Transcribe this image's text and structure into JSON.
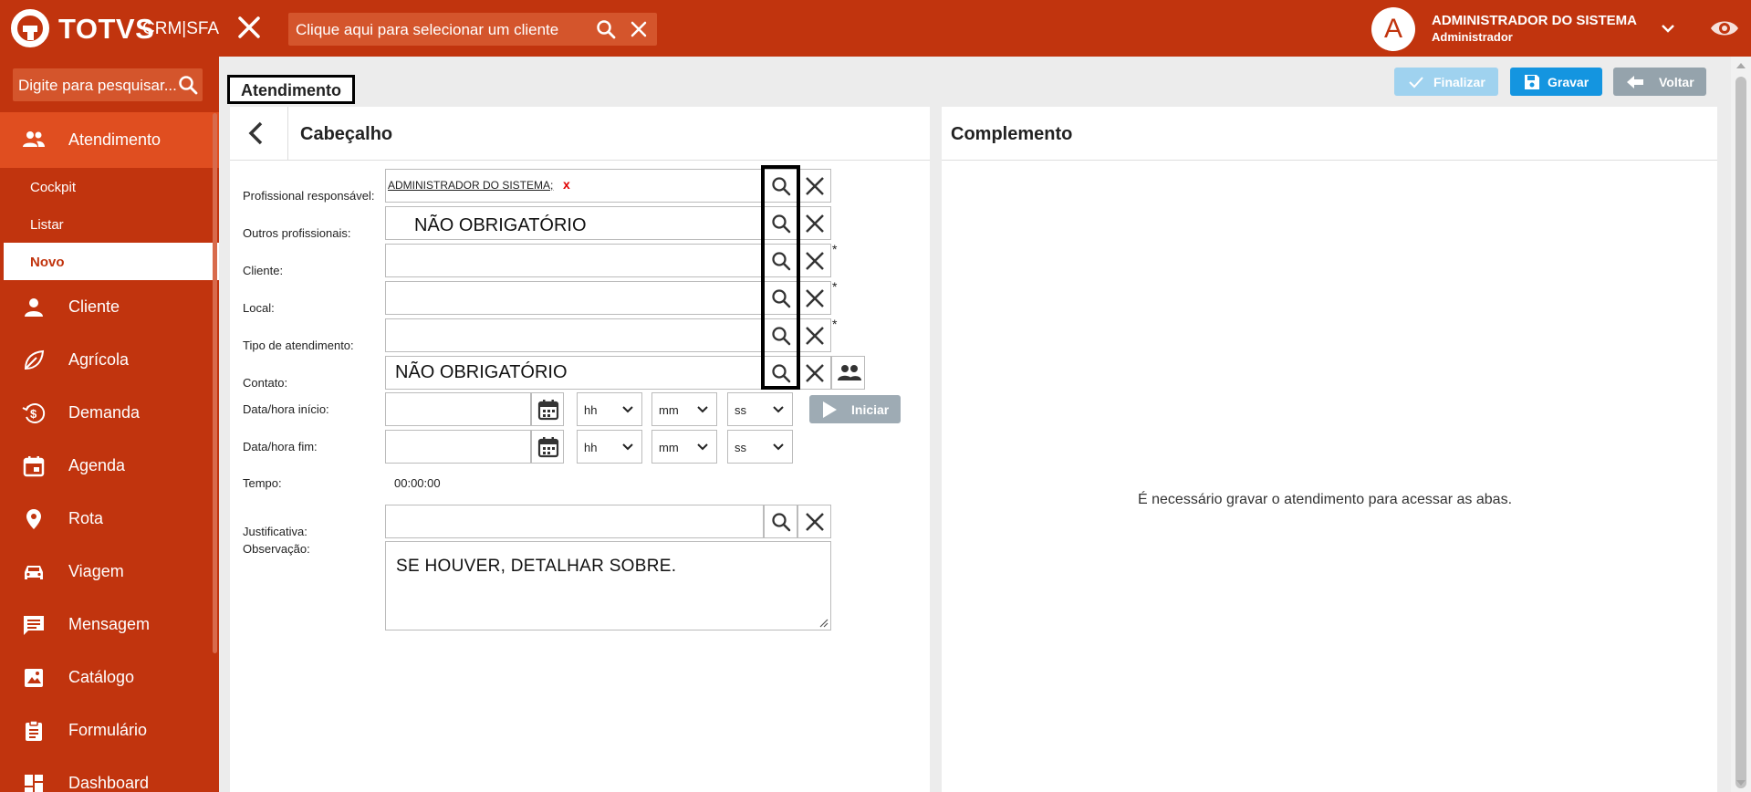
{
  "topbar": {
    "brand": "TOTVS",
    "brand_sub": "CRM|SFA",
    "client_placeholder": "Clique aqui para selecionar um cliente",
    "user_initial": "A",
    "user_name": "ADMINISTRADOR DO SISTEMA",
    "user_role": "Administrador"
  },
  "sidebar": {
    "search_placeholder": "Digite para pesquisar...",
    "items": [
      {
        "label": "Atendimento",
        "icon": "people-icon",
        "active": true
      },
      {
        "label": "Cliente",
        "icon": "person-icon"
      },
      {
        "label": "Agrícola",
        "icon": "leaf-icon"
      },
      {
        "label": "Demanda",
        "icon": "money-icon"
      },
      {
        "label": "Agenda",
        "icon": "calendar-icon"
      },
      {
        "label": "Rota",
        "icon": "location-pin-icon"
      },
      {
        "label": "Viagem",
        "icon": "car-icon"
      },
      {
        "label": "Mensagem",
        "icon": "message-icon"
      },
      {
        "label": "Catálogo",
        "icon": "image-icon"
      },
      {
        "label": "Formulário",
        "icon": "clipboard-icon"
      },
      {
        "label": "Dashboard",
        "icon": "dashboard-icon"
      }
    ],
    "subitems": [
      "Cockpit",
      "Listar",
      "Novo"
    ],
    "current_subitem": "Novo"
  },
  "header": {
    "page_title": "Atendimento",
    "buttons": {
      "finalizar": "Finalizar",
      "gravar": "Gravar",
      "voltar": "Voltar"
    }
  },
  "cabecalho": {
    "title": "Cabeçalho",
    "fields": {
      "profissional": {
        "label": "Profissional responsável:",
        "value": "ADMINISTRADOR DO SISTEMA;",
        "remove": "x"
      },
      "outros": {
        "label": "Outros profissionais:",
        "value": "NÃO OBRIGATÓRIO"
      },
      "cliente": {
        "label": "Cliente:",
        "required": "*"
      },
      "local": {
        "label": "Local:",
        "required": "*"
      },
      "tipo": {
        "label": "Tipo de atendimento:",
        "required": "*"
      },
      "contato": {
        "label": "Contato:",
        "value": "NÃO OBRIGATÓRIO"
      },
      "inicio": {
        "label": "Data/hora início:"
      },
      "fim": {
        "label": "Data/hora fim:"
      },
      "tempo": {
        "label": "Tempo:",
        "value": "00:00:00"
      },
      "justificativa": {
        "label": "Justificativa:"
      },
      "observacao": {
        "label": "Observação:",
        "value": "SE HOUVER, DETALHAR SOBRE."
      }
    },
    "time_selects": {
      "hh": "hh",
      "mm": "mm",
      "ss": "ss"
    },
    "iniciar": "Iniciar"
  },
  "complemento": {
    "title": "Complemento",
    "message": "É necessário gravar o atendimento para acessar as abas."
  },
  "colors": {
    "brand": "#c1340e",
    "primary": "#1495e0",
    "disabled": "#9fd2ef",
    "muted": "#95a3ac"
  }
}
